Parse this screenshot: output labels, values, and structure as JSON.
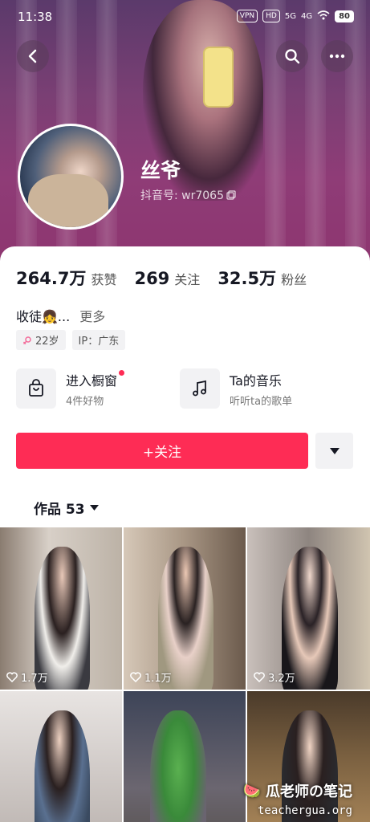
{
  "status_bar": {
    "time": "11:38",
    "vpn": "VPN",
    "hd": "HD",
    "signal_5g": "5G",
    "signal_4g": "4G",
    "battery": "80"
  },
  "profile": {
    "name": "丝爷",
    "douyin_id": "抖音号: wr7065"
  },
  "stats": [
    {
      "value": "264.7万",
      "label": "获赞"
    },
    {
      "value": "269",
      "label": "关注"
    },
    {
      "value": "32.5万",
      "label": "粉丝"
    }
  ],
  "bio": {
    "text": "收徒👧...",
    "more": "更多"
  },
  "tags": {
    "age": "22岁",
    "ip": "IP：广东"
  },
  "shortcuts": [
    {
      "title": "进入橱窗",
      "subtitle": "4件好物"
    },
    {
      "title": "Ta的音乐",
      "subtitle": "听听ta的歌单"
    }
  ],
  "follow_button": "+关注",
  "works_tab": "作品 53",
  "videos": [
    {
      "likes": "1.7万"
    },
    {
      "likes": "1.1万"
    },
    {
      "likes": "3.2万"
    },
    {
      "likes": ""
    },
    {
      "likes": ""
    },
    {
      "likes": ""
    }
  ],
  "watermark": {
    "title": "瓜老师の笔记",
    "site": "teachergua.org"
  },
  "colors": {
    "accent": "#fe2c55",
    "header": "#7a3f74"
  }
}
